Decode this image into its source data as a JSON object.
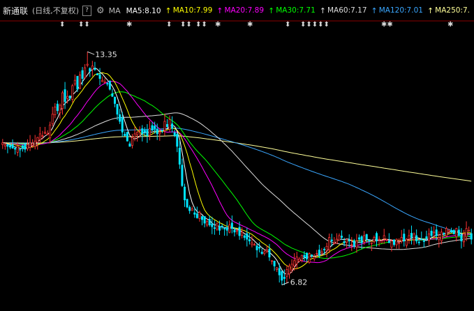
{
  "header": {
    "stock_name": "新通联",
    "period": "(日线,不复权)",
    "help_button": "?",
    "ma_label": "MA",
    "indicators": [
      {
        "label": "MA5:8.10",
        "color": "#ffffff"
      },
      {
        "label": "MA10:7.99",
        "color": "#ffff00"
      },
      {
        "label": "MA20:7.89",
        "color": "#ff00ff"
      },
      {
        "label": "MA30:7.71",
        "color": "#00ff00"
      },
      {
        "label": "MA60:7.17",
        "color": "#dddddd"
      },
      {
        "label": "MA120:7.01",
        "color": "#3aa7ff"
      },
      {
        "label": "MA250:7.",
        "color": "#ffff99"
      }
    ]
  },
  "event_markers": {
    "glyphs": [
      "⬍",
      "⬍⬍",
      "✱",
      "⬍",
      "⬍⬍",
      "⬍⬍",
      "✱",
      "✱",
      "⬍",
      "⬍⬍⬍⬍⬍",
      "✱✱",
      "✱"
    ]
  },
  "chart_data": {
    "type": "candlestick",
    "y_range": [
      6.5,
      13.9
    ],
    "high_label": "13.35",
    "low_label": "6.82",
    "colors": {
      "up": "#ff3232",
      "down": "#00e5ff"
    },
    "ma_final_values": {
      "MA5": 8.1,
      "MA10": 7.99,
      "MA20": 7.89,
      "MA30": 7.71,
      "MA60": 7.17,
      "MA120": 7.01
    },
    "closes": [
      10.8,
      10.75,
      10.7,
      10.68,
      10.65,
      10.62,
      10.7,
      10.6,
      10.65,
      10.62,
      10.75,
      10.8,
      10.78,
      10.85,
      10.95,
      11.05,
      11.0,
      11.1,
      11.05,
      11.3,
      11.6,
      11.8,
      11.7,
      11.85,
      12.2,
      11.95,
      12.1,
      12.05,
      12.4,
      12.55,
      12.3,
      12.7,
      12.6,
      12.9,
      13.0,
      12.8,
      12.95,
      12.85,
      12.7,
      12.6,
      12.55,
      12.5,
      12.45,
      12.3,
      12.1,
      11.9,
      11.6,
      11.4,
      11.1,
      11.0,
      10.85,
      10.7,
      10.95,
      11.05,
      11.1,
      11.15,
      11.05,
      11.1,
      11.0,
      11.2,
      11.15,
      11.2,
      11.05,
      11.1,
      11.15,
      11.4,
      11.25,
      11.45,
      11.2,
      11.0,
      10.7,
      10.2,
      9.6,
      9.2,
      9.0,
      8.9,
      8.95,
      8.8,
      8.7,
      8.85,
      8.65,
      8.55,
      8.6,
      8.5,
      8.45,
      8.4,
      8.55,
      8.35,
      8.45,
      8.4,
      8.35,
      8.5,
      8.4,
      8.3,
      8.35,
      8.2,
      8.3,
      8.15,
      8.1,
      8.05,
      8.0,
      7.95,
      7.8,
      7.85,
      7.7,
      7.75,
      7.8,
      7.6,
      7.5,
      7.35,
      7.3,
      7.1,
      6.95,
      7.0,
      7.25,
      7.35,
      7.4,
      7.5,
      7.6,
      7.55,
      7.65,
      7.6,
      7.55,
      7.7,
      7.65,
      7.6,
      7.7,
      7.65,
      7.75,
      7.8,
      7.9,
      8.15,
      8.05,
      8.0,
      8.1,
      8.2,
      8.15,
      8.0,
      8.1,
      8.05,
      7.95,
      7.9,
      8.05,
      8.1,
      8.0,
      8.2,
      8.1,
      8.05,
      8.0,
      8.15,
      8.05,
      8.1,
      8.05,
      8.2,
      8.1,
      8.0,
      8.05,
      7.95,
      8.1,
      8.0,
      8.15,
      8.05,
      8.1,
      8.2,
      8.15,
      8.25,
      8.05,
      8.0,
      8.1,
      8.05,
      8.1,
      8.25,
      8.2,
      8.3,
      8.2,
      8.15,
      8.3,
      8.25,
      8.4,
      8.35,
      8.3,
      8.25,
      8.4,
      8.2,
      8.05,
      8.25,
      8.4,
      8.35,
      8.1
    ]
  }
}
